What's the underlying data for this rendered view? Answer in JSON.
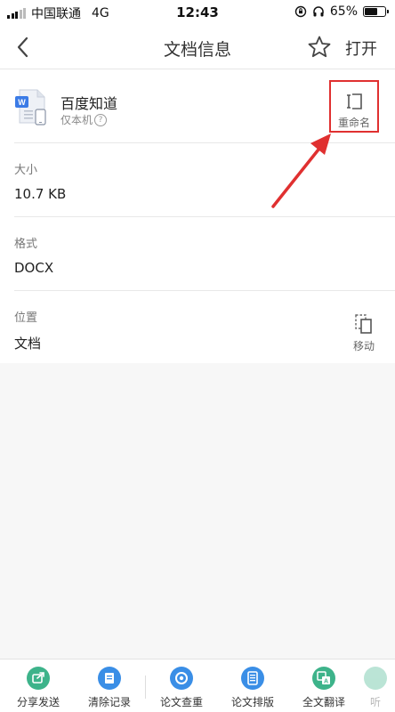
{
  "status_bar": {
    "carrier": "中国联通",
    "network": "4G",
    "time": "12:43",
    "battery_percent": "65%",
    "battery_level": 0.65
  },
  "nav": {
    "title": "文档信息",
    "open_label": "打开",
    "back_icon": "chevron-left-icon",
    "star_icon": "star-outline-icon"
  },
  "file": {
    "name": "百度知道",
    "location_tag": "仅本机",
    "rename_label": "重命名"
  },
  "info": {
    "size_label": "大小",
    "size_value": "10.7 KB",
    "format_label": "格式",
    "format_value": "DOCX",
    "location_label": "位置",
    "location_value": "文档",
    "move_label": "移动"
  },
  "toolbar": {
    "items": [
      {
        "label": "分享发送",
        "icon": "share-icon",
        "color": "#3db38a"
      },
      {
        "label": "清除记录",
        "icon": "clear-record-icon",
        "color": "#3a8ee6"
      },
      {
        "label": "论文查重",
        "icon": "paper-check-icon",
        "color": "#3a8ee6"
      },
      {
        "label": "论文排版",
        "icon": "paper-layout-icon",
        "color": "#3a8ee6"
      },
      {
        "label": "全文翻译",
        "icon": "translate-icon",
        "color": "#3db38a"
      },
      {
        "label": "听",
        "icon": "listen-icon",
        "color": "#3db38a"
      }
    ]
  },
  "colors": {
    "highlight_box": "#e03030",
    "annotation_arrow": "#e03030",
    "accent_green": "#3db38a",
    "accent_blue": "#3a8ee6"
  }
}
